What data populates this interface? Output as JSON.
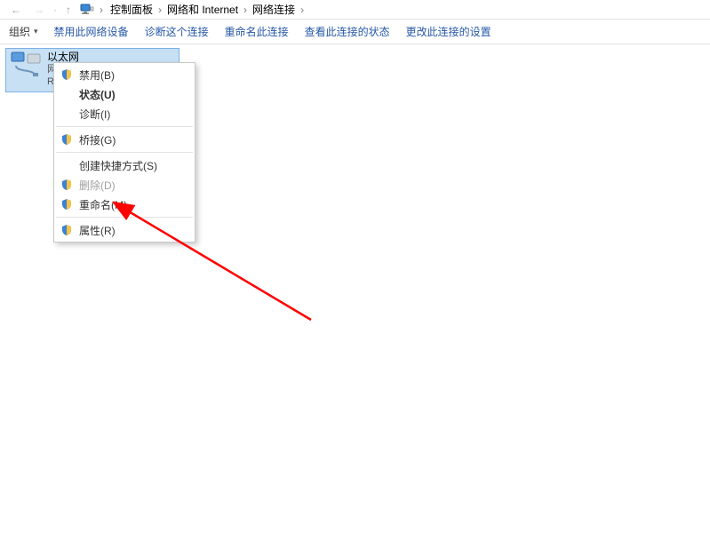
{
  "breadcrumb": {
    "items": [
      "控制面板",
      "网络和 Internet",
      "网络连接"
    ]
  },
  "toolbar": {
    "organize": "组织",
    "items": [
      "禁用此网络设备",
      "诊断这个连接",
      "重命名此连接",
      "查看此连接的状态",
      "更改此连接的设置"
    ]
  },
  "adapter": {
    "name": "以太网",
    "line2": "网络",
    "line3": "Re..."
  },
  "context_menu": {
    "disable": "禁用(B)",
    "status": "状态(U)",
    "diagnose": "诊断(I)",
    "bridge": "桥接(G)",
    "shortcut": "创建快捷方式(S)",
    "delete": "删除(D)",
    "rename": "重命名(M)",
    "properties": "属性(R)"
  }
}
